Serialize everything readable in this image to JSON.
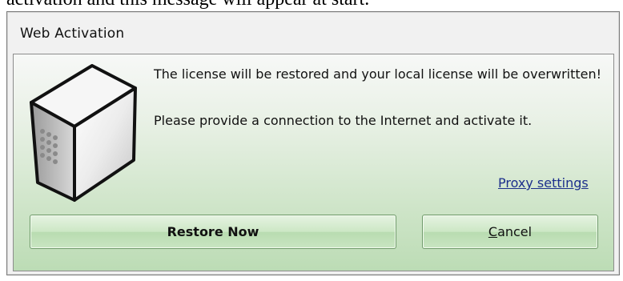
{
  "background_text": "activation and this message will appear at start.",
  "dialog": {
    "title": "Web Activation",
    "message_1": "The license will be restored and your local license will be overwritten!",
    "message_2": "Please provide a connection to the Internet and activate it.",
    "proxy_link": "Proxy settings",
    "buttons": {
      "restore_label": "Restore Now",
      "cancel_first": "C",
      "cancel_rest": "ancel"
    },
    "icon": "server-box-icon",
    "colors": {
      "content_gradient_top": "#f7f8f7",
      "content_gradient_bottom": "#bcdcb5",
      "link": "#1c2f8c"
    }
  }
}
